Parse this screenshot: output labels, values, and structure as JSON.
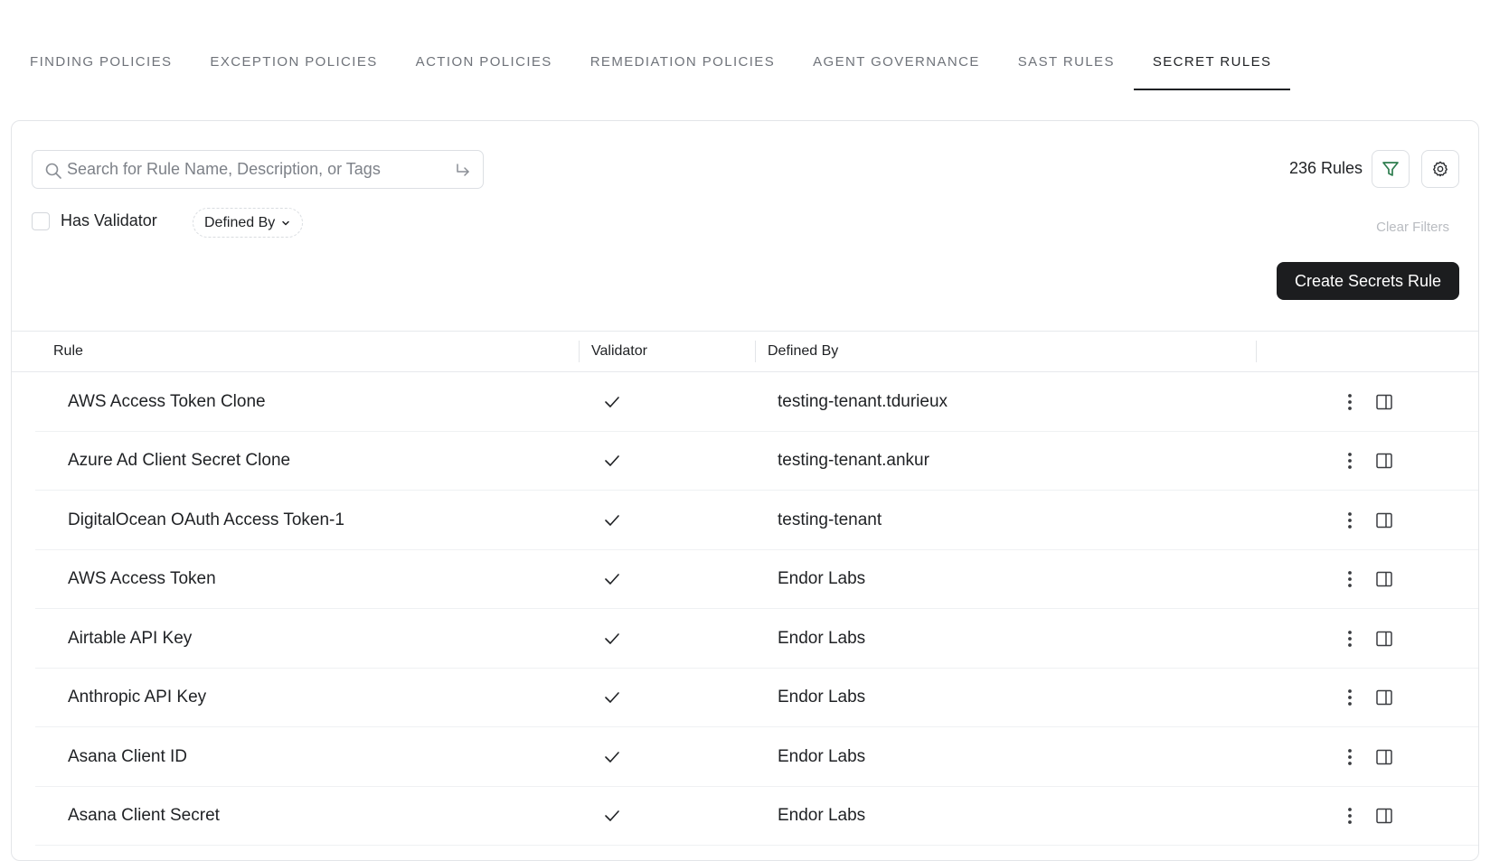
{
  "tabs": [
    {
      "label": "FINDING POLICIES",
      "active": false
    },
    {
      "label": "EXCEPTION POLICIES",
      "active": false
    },
    {
      "label": "ACTION POLICIES",
      "active": false
    },
    {
      "label": "REMEDIATION POLICIES",
      "active": false
    },
    {
      "label": "AGENT GOVERNANCE",
      "active": false
    },
    {
      "label": "SAST RULES",
      "active": false
    },
    {
      "label": "SECRET RULES",
      "active": true
    }
  ],
  "search": {
    "placeholder": "Search for Rule Name, Description, or Tags",
    "value": "",
    "icon": "search-icon",
    "submit_icon": "enter-icon"
  },
  "rule_count": "236 Rules",
  "filters": {
    "has_validator_label": "Has Validator",
    "has_validator_checked": false,
    "defined_by_label": "Defined By",
    "clear_label": "Clear Filters"
  },
  "create_button": "Create Secrets Rule",
  "table": {
    "headers": {
      "rule": "Rule",
      "validator": "Validator",
      "defined_by": "Defined By"
    },
    "rows": [
      {
        "rule": "AWS Access Token Clone",
        "validator": true,
        "defined_by": "testing-tenant.tdurieux"
      },
      {
        "rule": "Azure Ad Client Secret Clone",
        "validator": true,
        "defined_by": "testing-tenant.ankur"
      },
      {
        "rule": "DigitalOcean OAuth Access Token-1",
        "validator": true,
        "defined_by": "testing-tenant"
      },
      {
        "rule": "AWS Access Token",
        "validator": true,
        "defined_by": "Endor Labs"
      },
      {
        "rule": "Airtable API Key",
        "validator": true,
        "defined_by": "Endor Labs"
      },
      {
        "rule": "Anthropic API Key",
        "validator": true,
        "defined_by": "Endor Labs"
      },
      {
        "rule": "Asana Client ID",
        "validator": true,
        "defined_by": "Endor Labs"
      },
      {
        "rule": "Asana Client Secret",
        "validator": true,
        "defined_by": "Endor Labs"
      }
    ]
  },
  "colors": {
    "filter_icon": "#2e7d4f",
    "primary_button": "#1c1d1f",
    "text": "#1f2124",
    "muted": "#6f737a"
  }
}
